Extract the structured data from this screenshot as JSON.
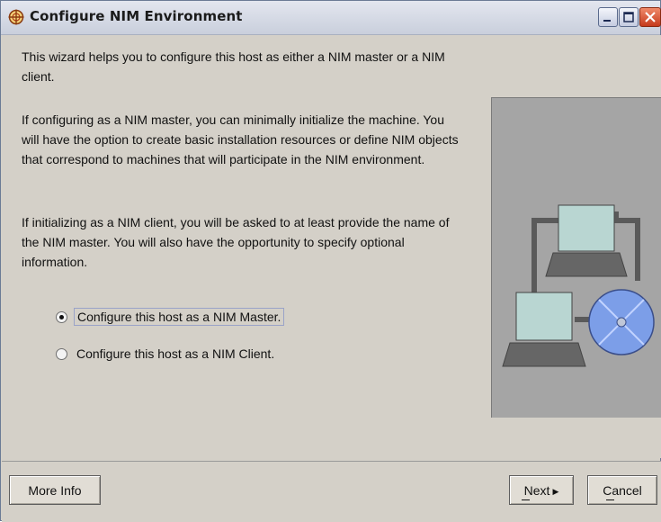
{
  "window": {
    "title": "Configure NIM Environment",
    "icon": "app-compass-icon",
    "controls": [
      "minimize-icon",
      "maximize-icon",
      "close-icon"
    ]
  },
  "content": {
    "paragraphs": [
      "This wizard helps you to configure this host as either a NIM master or a NIM client.",
      "If configuring as a NIM master, you can minimally initialize the machine. You will have the option to create basic installation resources or define NIM objects that correspond to machines that will participate in the NIM environment.",
      "If initializing as a NIM client, you will be asked to at least provide the name of the NIM master. You will also have the opportunity to specify optional information."
    ],
    "options": [
      {
        "label": "Configure this host as a NIM Master.",
        "selected": true
      },
      {
        "label": "Configure this host as a NIM Client.",
        "selected": false
      }
    ]
  },
  "buttons": {
    "more_info": "More Info",
    "next": "Next",
    "cancel": "Cancel"
  },
  "colors": {
    "window_bg": "#d4d0c8",
    "illustration_bg": "#a5a5a5",
    "close_button": "#d0472a"
  }
}
